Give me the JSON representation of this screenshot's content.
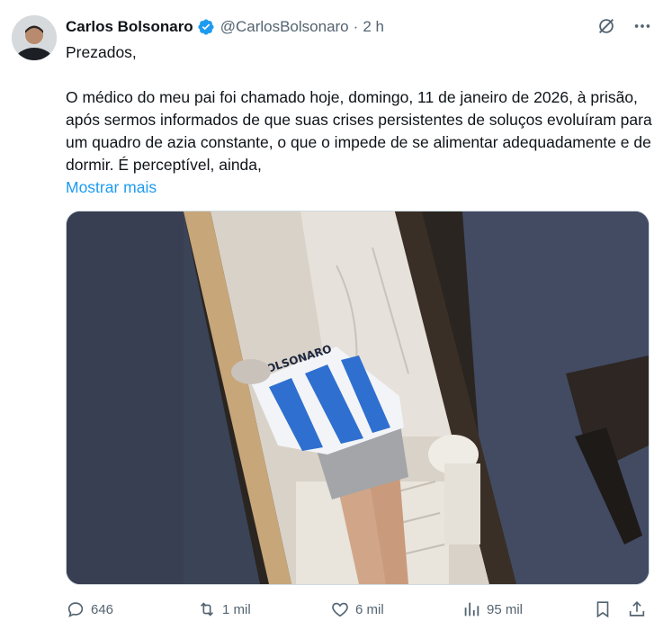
{
  "author": {
    "name": "Carlos Bolsonaro",
    "handle": "@CarlosBolsonaro",
    "separator": "·",
    "time": "2 h"
  },
  "tweet": {
    "line1": "Prezados,",
    "body": "O médico do meu pai foi chamado hoje, domingo, 11 de janeiro de 2026, à prisão, após sermos informados de que suas crises persistentes de soluços evoluíram para um quadro de azia constante, o que o impede de se alimentar adequadamente e de dormir. É perceptível, ainda,",
    "show_more": "Mostrar mais"
  },
  "media": {
    "jersey_text": "BOLSONARO"
  },
  "actions": {
    "replies": "646",
    "reposts": "1 mil",
    "likes": "6 mil",
    "views": "95 mil"
  },
  "colors": {
    "accent": "#1d9bf0",
    "muted": "#536471",
    "verified": "#1d9bf0"
  },
  "icons": [
    "grok-icon",
    "more-icon",
    "verified-badge-icon",
    "reply-icon",
    "retweet-icon",
    "like-icon",
    "views-icon",
    "bookmark-icon",
    "share-icon"
  ]
}
